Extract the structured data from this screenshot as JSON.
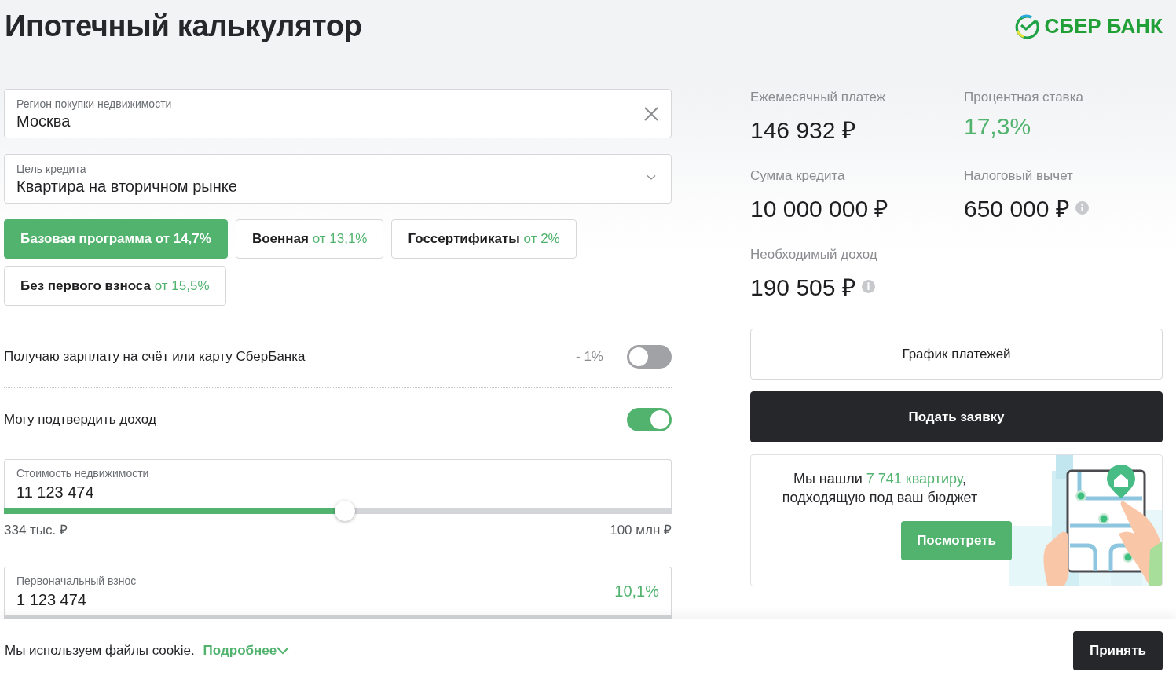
{
  "header": {
    "title": "Ипотечный калькулятор",
    "logo_text": "СБЕР БАНК"
  },
  "fields": [
    {
      "kind": "clearable",
      "label": "Регион покупки недвижимости",
      "value": "Москва"
    },
    {
      "kind": "select",
      "label": "Цель кредита",
      "value": "Квартира на вторичном рынке"
    }
  ],
  "programs": [
    {
      "name": "Базовая программа",
      "rate": "от 14,7%",
      "selected": true
    },
    {
      "name": "Военная",
      "rate": "от 13,1%",
      "selected": false
    },
    {
      "name": "Госсертификаты",
      "rate": "от 2%",
      "selected": false
    },
    {
      "name": "Без первого взноса",
      "rate": "от 15,5%",
      "selected": false
    }
  ],
  "toggles": [
    {
      "label": "Получаю зарплату на счёт или карту СберБанка",
      "note": "- 1%",
      "on": false
    },
    {
      "label": "Могу подтвердить доход",
      "on": true
    }
  ],
  "sliders": [
    {
      "label": "Стоимость недвижимости",
      "value": "11 123 474",
      "level": 0.51,
      "min_label": "334 тыс. ₽",
      "max_label": "100 млн ₽"
    },
    {
      "label": "Первоначальный взнос",
      "value": "1 123 474",
      "share": "10,1%"
    }
  ],
  "results": [
    {
      "label": "Ежемесячный платеж",
      "value": "146 932 ₽",
      "highlight": false,
      "info": false
    },
    {
      "label": "Процентная ставка",
      "value": "17,3%",
      "highlight": true,
      "info": false
    },
    {
      "label": "Сумма кредита",
      "value": "10 000 000 ₽",
      "highlight": false,
      "info": false
    },
    {
      "label": "Налоговый вычет",
      "value": "650 000 ₽",
      "highlight": false,
      "info": true
    },
    {
      "label": "Необходимый доход",
      "value": "190 505 ₽",
      "highlight": false,
      "info": true
    }
  ],
  "actions": [
    {
      "kind": "outline",
      "label": "График платежей"
    },
    {
      "kind": "primary",
      "label": "Подать заявку"
    }
  ],
  "promo": {
    "text_before": "Мы нашли",
    "highlight": "7 741 квартиру",
    "text_after": ",",
    "line_2": "подходящую под ваш бюджет",
    "button": "Посмотреть"
  },
  "cookie": {
    "text": "Мы используем файлы cookie.",
    "link": "Подробнее",
    "button": "Принять"
  }
}
